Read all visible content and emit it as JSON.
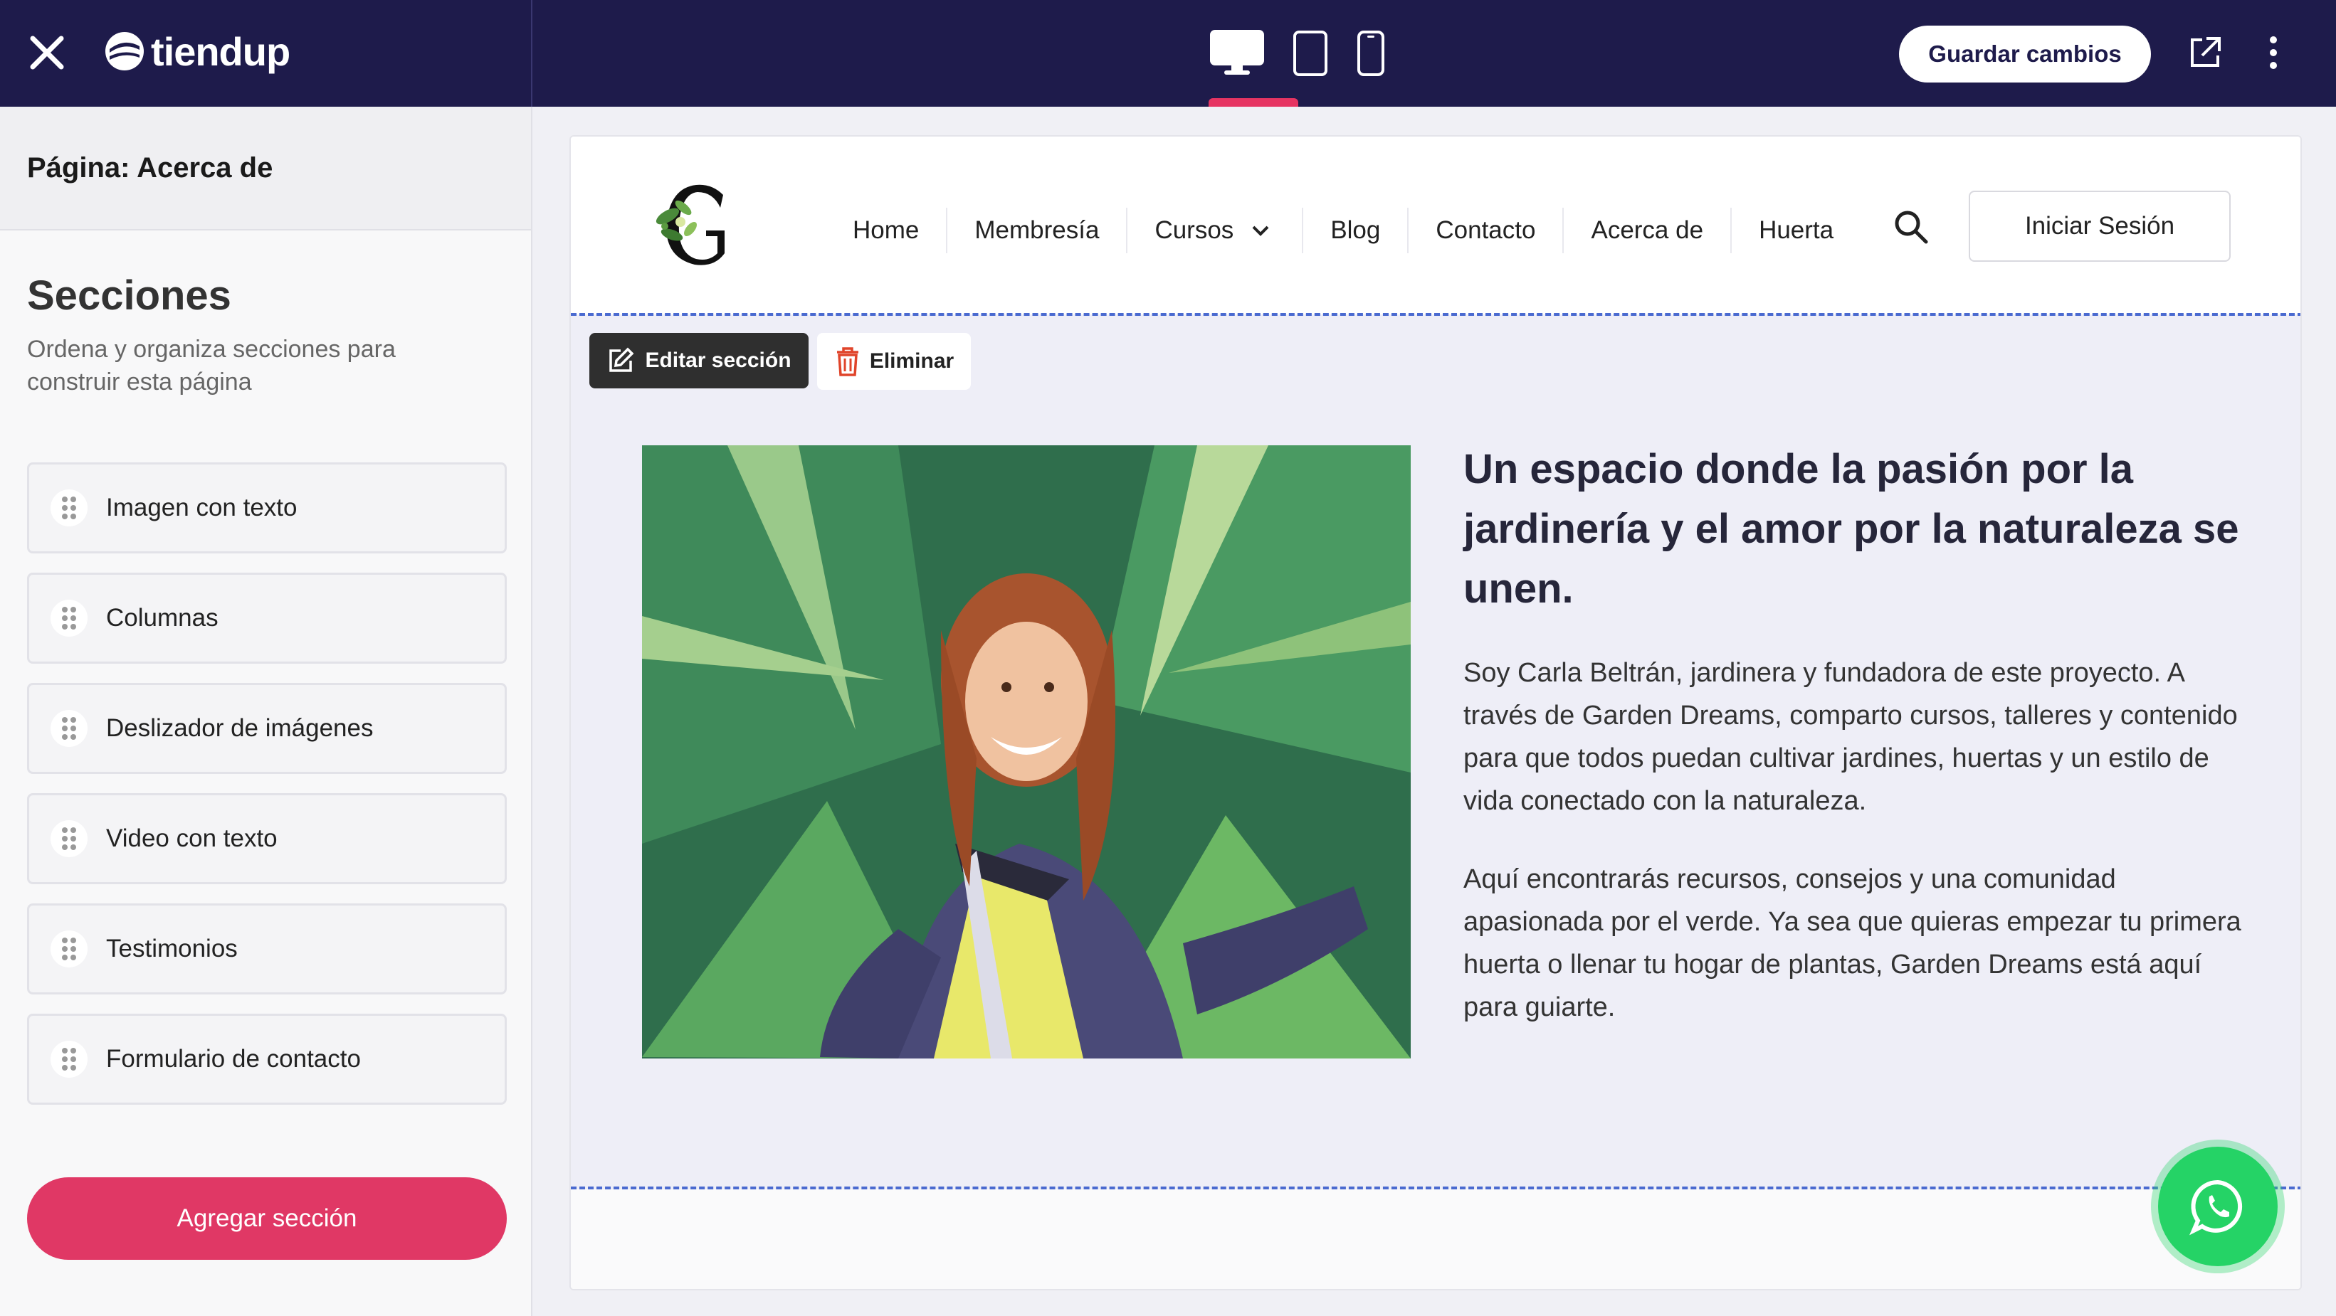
{
  "topbar": {
    "brand": "tiendup",
    "save_label": "Guardar cambios",
    "active_device": "desktop",
    "colors": {
      "bg": "#1e1b4b",
      "accent": "#e63462"
    }
  },
  "sidebar": {
    "page_label": "Página: Acerca de",
    "sections_title": "Secciones",
    "sections_desc": "Ordena y organiza secciones para construir esta página",
    "items": [
      {
        "label": "Imagen con texto"
      },
      {
        "label": "Columnas"
      },
      {
        "label": "Deslizador de imágenes"
      },
      {
        "label": "Video con texto"
      },
      {
        "label": "Testimonios"
      },
      {
        "label": "Formulario de contacto"
      }
    ],
    "add_label": "Agregar sección"
  },
  "site": {
    "nav": [
      {
        "label": "Home"
      },
      {
        "label": "Membresía"
      },
      {
        "label": "Cursos"
      },
      {
        "label": "Blog"
      },
      {
        "label": "Contacto"
      },
      {
        "label": "Acerca de"
      },
      {
        "label": "Huerta"
      }
    ],
    "login_label": "Iniciar Sesión"
  },
  "section_toolbar": {
    "edit_label": "Editar sección",
    "delete_label": "Eliminar"
  },
  "content": {
    "headline": "Un espacio donde la pasión por la jardinería y el amor por la naturaleza se unen.",
    "para1": "Soy Carla Beltrán, jardinera y fundadora de este proyecto. A través de Garden Dreams, comparto cursos, talleres y contenido para que todos puedan cultivar jardines, huertas y un estilo de vida conectado con la naturaleza.",
    "para2": "Aquí encontrarás recursos, consejos y una comunidad apasionada por el verde. Ya sea que quieras empezar tu primera huerta o llenar tu hogar de plantas, Garden Dreams está aquí para guiarte."
  }
}
